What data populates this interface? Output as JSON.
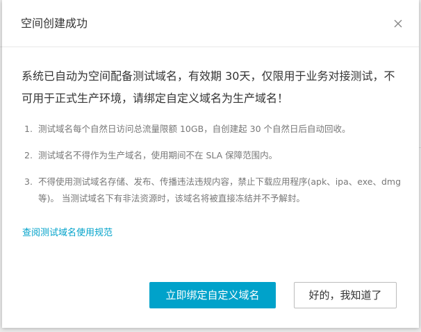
{
  "dialog": {
    "title": "空间创建成功",
    "lead": "系统已自动为空间配备测试域名，有效期 30天，仅限用于业务对接测试，不可用于正式生产环境，请绑定自定义域名为生产域名！",
    "rules": [
      {
        "num": "1.",
        "text": "测试域名每个自然日访问总流量限额  10GB，自创建起  30  个自然日后自动回收。"
      },
      {
        "num": "2.",
        "text": "测试域名不得作为生产域名，使用期间不在 SLA 保障范围内。"
      },
      {
        "num": "3.",
        "text": "不得使用测试域名存储、发布、传播违法违规内容，禁止下载应用程序(apk、ipa、exe、dmg 等)。 当测试域名下有非法资源时，该域名将被直接冻结并不予解封。"
      }
    ],
    "spec_link": "查阅测试域名使用规范",
    "primary_button": "立即绑定自定义域名",
    "secondary_button": "好的，我知道了",
    "close_icon": "close-icon"
  },
  "colors": {
    "accent": "#00a2ca",
    "text": "#333333",
    "muted": "#777777"
  }
}
